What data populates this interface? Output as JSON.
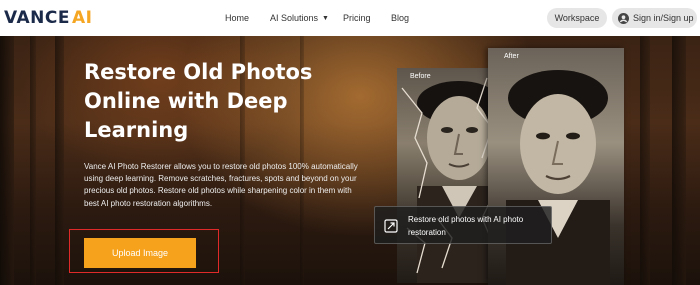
{
  "nav": {
    "logo_part1": "VANCE",
    "logo_part2": "AI",
    "links": [
      "Home",
      "AI Solutions",
      "Pricing",
      "Blog"
    ],
    "workspace": "Workspace",
    "signin": "Sign in/Sign up"
  },
  "hero": {
    "title": "Restore Old Photos Online with Deep Learning",
    "description": "Vance AI Photo Restorer allows you to restore old photos 100% automatically using deep learning. Remove scratches, fractures, spots and beyond on your precious old photos. Restore old photos while sharpening color in them with best AI photo restoration algorithms.",
    "upload_button": "Upload Image"
  },
  "comparison": {
    "before_label": "Before",
    "after_label": "After",
    "caption": "Restore old photos with AI photo restoration"
  },
  "colors": {
    "accent": "#f6a21c",
    "logo_dark": "#1c2a4a",
    "highlight": "#e02a2a"
  }
}
